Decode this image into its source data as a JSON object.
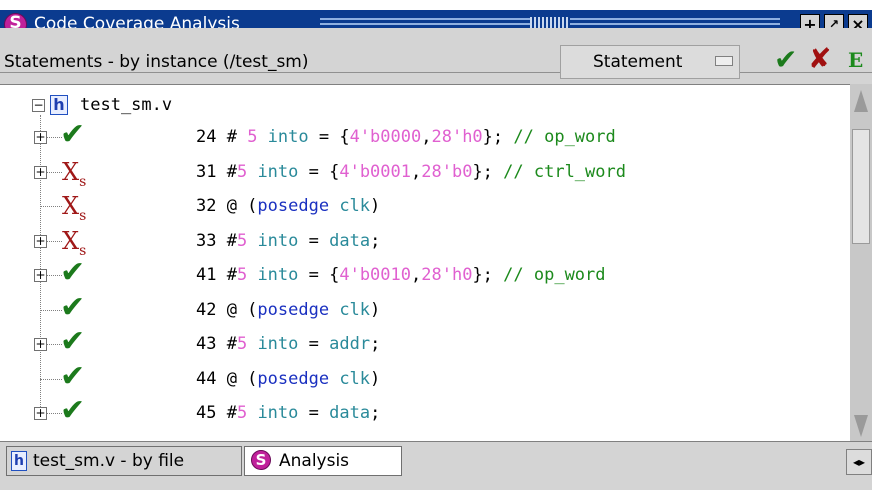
{
  "window": {
    "title": "Code Coverage Analysis",
    "controls": [
      "+",
      "↗",
      "×"
    ],
    "icon": "questa-logo-icon"
  },
  "header": {
    "text": "Statements - by instance (/test_sm)",
    "dropdown_value": "Statement",
    "toolbar_icons": [
      "green-check-icon",
      "red-x-icon",
      "e-icon"
    ]
  },
  "tree": {
    "root": "test_sm.v",
    "rows": [
      {
        "status": "hit",
        "expand": true,
        "code": [
          {
            "t": "24 # ",
            "c": "k"
          },
          {
            "t": "5",
            "c": "n"
          },
          {
            "t": " into",
            "c": "id"
          },
          {
            "t": " = {",
            "c": "k"
          },
          {
            "t": "4'b0000",
            "c": "n"
          },
          {
            "t": ",",
            "c": "k"
          },
          {
            "t": "28'h0",
            "c": "n"
          },
          {
            "t": "}; ",
            "c": "k"
          },
          {
            "t": "// op_word",
            "c": "cm"
          }
        ]
      },
      {
        "status": "miss",
        "expand": true,
        "code": [
          {
            "t": "31 #",
            "c": "k"
          },
          {
            "t": "5",
            "c": "n"
          },
          {
            "t": " into",
            "c": "id"
          },
          {
            "t": " = {",
            "c": "k"
          },
          {
            "t": "4'b0001",
            "c": "n"
          },
          {
            "t": ",",
            "c": "k"
          },
          {
            "t": "28'b0",
            "c": "n"
          },
          {
            "t": "}; ",
            "c": "k"
          },
          {
            "t": "// ctrl_word",
            "c": "cm"
          }
        ]
      },
      {
        "status": "miss",
        "expand": false,
        "code": [
          {
            "t": "32 @ (",
            "c": "k"
          },
          {
            "t": "posedge",
            "c": "b"
          },
          {
            "t": " clk",
            "c": "id"
          },
          {
            "t": ")",
            "c": "k"
          }
        ]
      },
      {
        "status": "miss",
        "expand": true,
        "code": [
          {
            "t": "33 #",
            "c": "k"
          },
          {
            "t": "5",
            "c": "n"
          },
          {
            "t": " into",
            "c": "id"
          },
          {
            "t": " = ",
            "c": "k"
          },
          {
            "t": "data",
            "c": "id"
          },
          {
            "t": ";",
            "c": "k"
          }
        ]
      },
      {
        "status": "hit",
        "expand": true,
        "code": [
          {
            "t": "41 #",
            "c": "k"
          },
          {
            "t": "5",
            "c": "n"
          },
          {
            "t": " into",
            "c": "id"
          },
          {
            "t": " = {",
            "c": "k"
          },
          {
            "t": "4'b0010",
            "c": "n"
          },
          {
            "t": ",",
            "c": "k"
          },
          {
            "t": "28'h0",
            "c": "n"
          },
          {
            "t": "}; ",
            "c": "k"
          },
          {
            "t": "// op_word",
            "c": "cm"
          }
        ]
      },
      {
        "status": "hit",
        "expand": false,
        "code": [
          {
            "t": "42 @ (",
            "c": "k"
          },
          {
            "t": "posedge",
            "c": "b"
          },
          {
            "t": " clk",
            "c": "id"
          },
          {
            "t": ")",
            "c": "k"
          }
        ]
      },
      {
        "status": "hit",
        "expand": true,
        "code": [
          {
            "t": "43 #",
            "c": "k"
          },
          {
            "t": "5",
            "c": "n"
          },
          {
            "t": " into",
            "c": "id"
          },
          {
            "t": " = ",
            "c": "k"
          },
          {
            "t": "addr",
            "c": "id"
          },
          {
            "t": ";",
            "c": "k"
          }
        ]
      },
      {
        "status": "hit",
        "expand": false,
        "code": [
          {
            "t": "44 @ (",
            "c": "k"
          },
          {
            "t": "posedge",
            "c": "b"
          },
          {
            "t": " clk",
            "c": "id"
          },
          {
            "t": ")",
            "c": "k"
          }
        ]
      },
      {
        "status": "hit",
        "expand": true,
        "code": [
          {
            "t": "45 #",
            "c": "k"
          },
          {
            "t": "5",
            "c": "n"
          },
          {
            "t": " into",
            "c": "id"
          },
          {
            "t": " = ",
            "c": "k"
          },
          {
            "t": "data",
            "c": "id"
          },
          {
            "t": ";",
            "c": "k"
          }
        ]
      }
    ]
  },
  "tabs": [
    {
      "label": "test_sm.v - by file",
      "icon": "h-file-icon"
    },
    {
      "label": "Analysis",
      "icon": "questa-logo-icon"
    }
  ],
  "colors": {
    "titlebar": "#0b3b8f",
    "hit": "#1c7a1c",
    "miss": "#a01818"
  }
}
